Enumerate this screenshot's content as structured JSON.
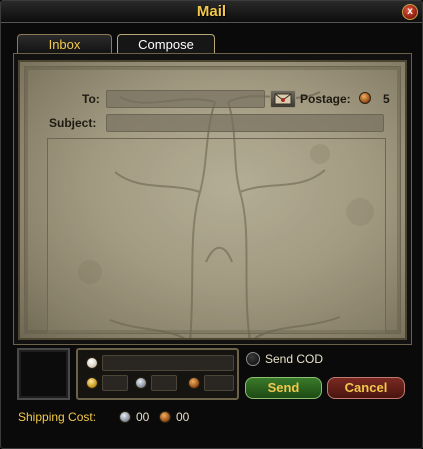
{
  "window": {
    "title": "Mail",
    "close_glyph": "x"
  },
  "tabs": [
    {
      "label": "Inbox",
      "active": false
    },
    {
      "label": "Compose",
      "active": true
    }
  ],
  "compose": {
    "to_label": "To:",
    "to_value": "",
    "postage_label": "Postage:",
    "postage_value": "5",
    "subject_label": "Subject:",
    "subject_value": "",
    "body_value": ""
  },
  "attachment": {
    "send_cod_label": "Send COD",
    "send_label": "Send",
    "cancel_label": "Cancel"
  },
  "shipping": {
    "label": "Shipping Cost:",
    "silver_value": "00",
    "copper_value": "00"
  },
  "colors": {
    "title": "#f2c84b",
    "send_button": "#2c6a1e",
    "cancel_button": "#6a1e18",
    "parchment": "#a39b82"
  },
  "icons": {
    "close": "close-icon",
    "contacts": "envelope-icon",
    "coins": [
      "platinum-coin-icon",
      "gold-coin-icon",
      "silver-coin-icon",
      "copper-coin-icon"
    ]
  }
}
